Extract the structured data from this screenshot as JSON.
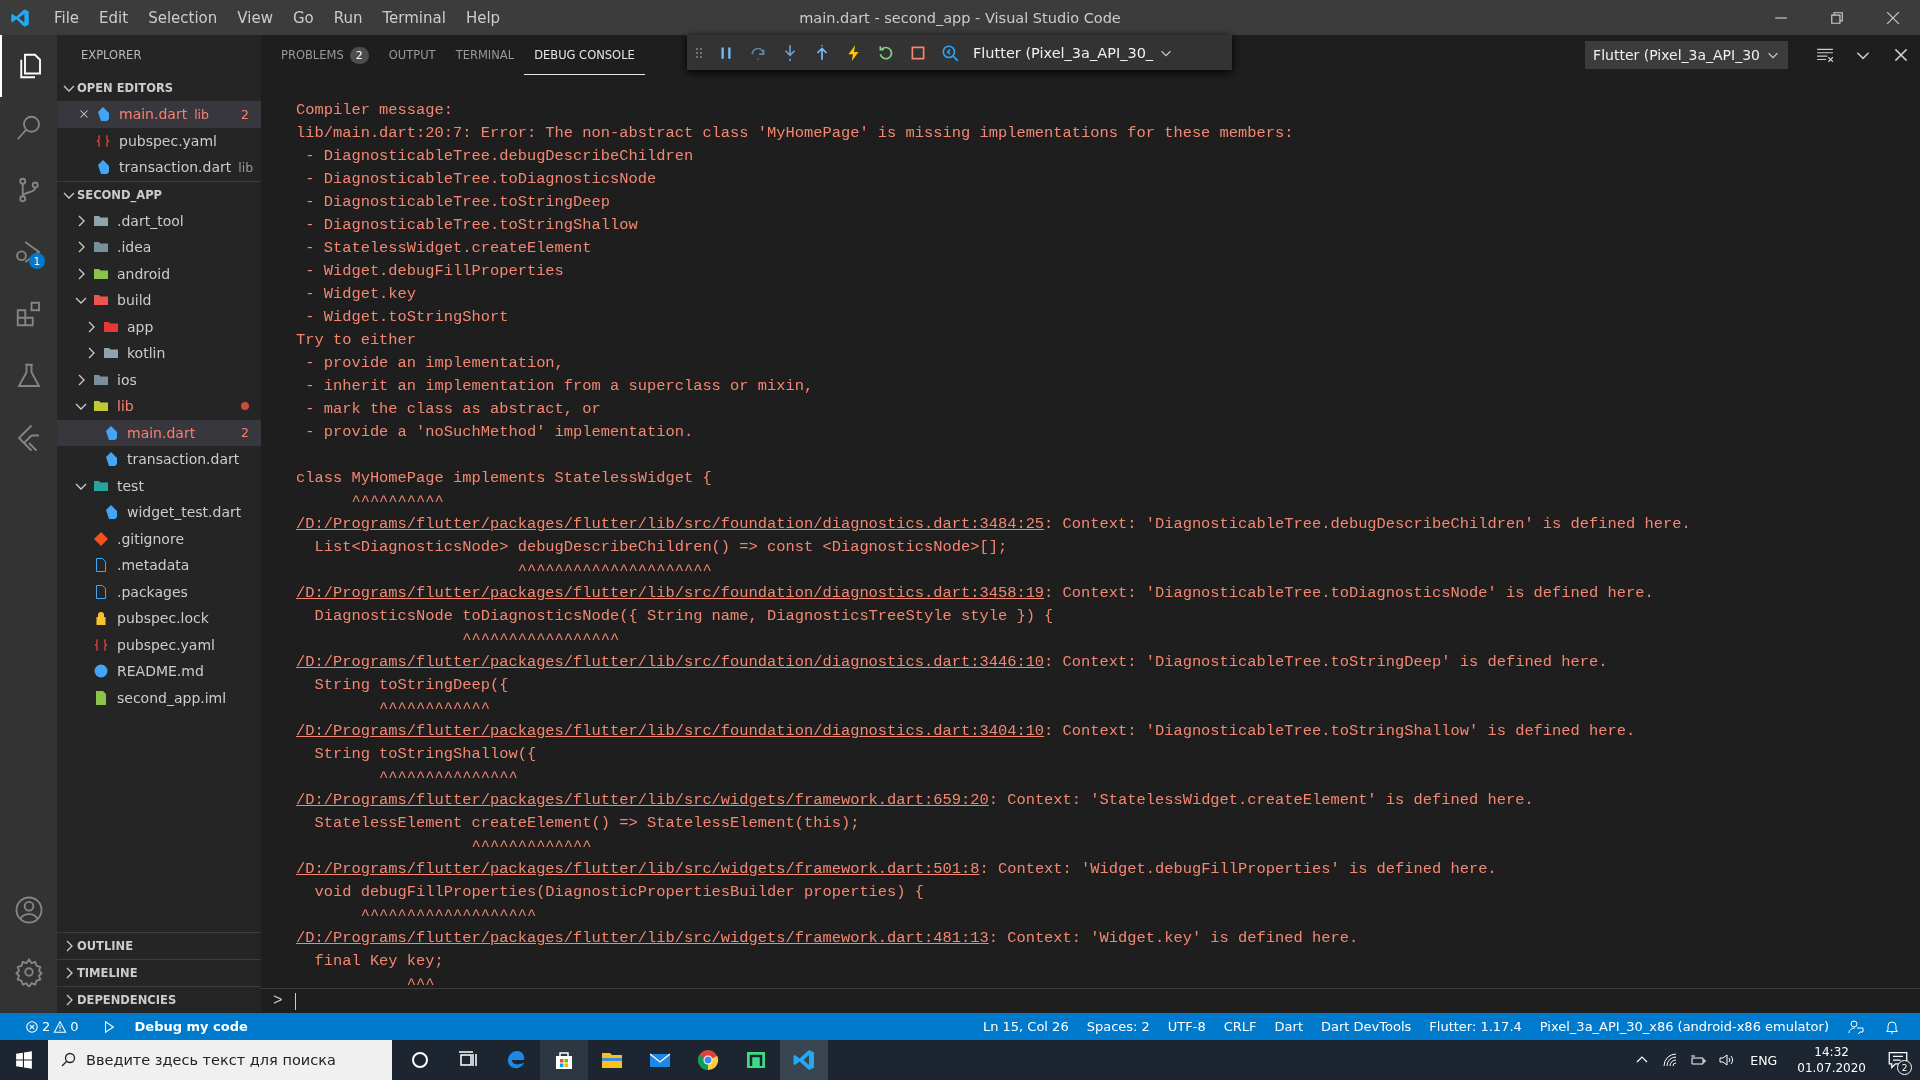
{
  "menu": [
    "File",
    "Edit",
    "Selection",
    "View",
    "Go",
    "Run",
    "Terminal",
    "Help"
  ],
  "window": {
    "title": "main.dart - second_app - Visual Studio Code"
  },
  "activity_bar": [
    {
      "kind": "files",
      "selected": true
    },
    {
      "kind": "search",
      "selected": false
    },
    {
      "kind": "scm",
      "selected": false
    },
    {
      "kind": "debug",
      "selected": false,
      "badge": "1"
    },
    {
      "kind": "extensions",
      "selected": false
    },
    {
      "kind": "testing",
      "selected": false
    },
    {
      "kind": "flutter",
      "selected": false
    }
  ],
  "activity_bottom": [
    {
      "kind": "account"
    },
    {
      "kind": "settings"
    }
  ],
  "explorer": {
    "title": "EXPLORER",
    "open_editors": {
      "title": "OPEN EDITORS",
      "expanded": true,
      "items": [
        {
          "name": "main.dart",
          "detail": "lib",
          "problems": "2",
          "error": true,
          "selected": true,
          "kind": "dart"
        },
        {
          "name": "pubspec.yaml",
          "error": false,
          "selected": false,
          "kind": "yaml"
        },
        {
          "name": "transaction.dart",
          "detail": "lib",
          "error": false,
          "selected": false,
          "kind": "dart"
        }
      ]
    },
    "project": {
      "title": "SECOND_APP",
      "expanded": true
    },
    "tree": [
      {
        "name": ".dart_tool",
        "kind": "folder",
        "expanded": false,
        "selected": false,
        "error": false
      },
      {
        "name": ".idea",
        "kind": "folder-idea",
        "expanded": false,
        "selected": false,
        "error": false
      },
      {
        "name": "android",
        "kind": "folder-android",
        "expanded": false,
        "selected": false,
        "error": false
      },
      {
        "name": "build",
        "kind": "folder-build",
        "expanded": true,
        "selected": false,
        "error": false,
        "children": [
          {
            "name": "app",
            "kind": "folder-app",
            "expanded": false,
            "selected": false,
            "error": false
          },
          {
            "name": "kotlin",
            "kind": "folder",
            "expanded": false,
            "selected": false,
            "error": false
          }
        ]
      },
      {
        "name": "ios",
        "kind": "folder-ios",
        "expanded": false,
        "selected": false,
        "error": false
      },
      {
        "name": "lib",
        "kind": "folder-lib",
        "expanded": true,
        "selected": false,
        "error": true,
        "dot": true,
        "children": [
          {
            "name": "main.dart",
            "kind": "dart",
            "selected": true,
            "error": true,
            "problems": "2"
          },
          {
            "name": "transaction.dart",
            "kind": "dart",
            "selected": false,
            "error": false
          }
        ]
      },
      {
        "name": "test",
        "kind": "folder-test",
        "expanded": true,
        "selected": false,
        "error": false,
        "children": [
          {
            "name": "widget_test.dart",
            "kind": "dart",
            "selected": false,
            "error": false
          }
        ]
      },
      {
        "name": ".gitignore",
        "kind": "git",
        "selected": false,
        "error": false
      },
      {
        "name": ".metadata",
        "kind": "doc",
        "selected": false,
        "error": false
      },
      {
        "name": ".packages",
        "kind": "doc",
        "selected": false,
        "error": false
      },
      {
        "name": "pubspec.lock",
        "kind": "lock",
        "selected": false,
        "error": false
      },
      {
        "name": "pubspec.yaml",
        "kind": "yaml",
        "selected": false,
        "error": false
      },
      {
        "name": "README.md",
        "kind": "info",
        "selected": false,
        "error": false
      },
      {
        "name": "second_app.iml",
        "kind": "iml",
        "selected": false,
        "error": false
      }
    ],
    "bottom_sections": [
      {
        "title": "OUTLINE",
        "expanded": false
      },
      {
        "title": "TIMELINE",
        "expanded": false
      },
      {
        "title": "DEPENDENCIES",
        "expanded": false
      }
    ]
  },
  "panel": {
    "tabs": [
      {
        "label": "PROBLEMS",
        "badge": "2",
        "selected": false
      },
      {
        "label": "OUTPUT",
        "selected": false
      },
      {
        "label": "TERMINAL",
        "selected": false
      },
      {
        "label": "DEBUG CONSOLE",
        "selected": true
      }
    ],
    "session_dropdown": "Flutter (Pixel_3a_API_30",
    "debug_toolbar": {
      "buttons": [
        {
          "kind": "pause"
        },
        {
          "kind": "step-over"
        },
        {
          "kind": "step-into"
        },
        {
          "kind": "step-out"
        },
        {
          "kind": "hot-reload"
        },
        {
          "kind": "restart"
        },
        {
          "kind": "stop"
        },
        {
          "kind": "devtools"
        }
      ],
      "session": "Flutter (Pixel_3a_API_30_"
    },
    "console": [
      {
        "kind": "text",
        "text": "Compiler message:"
      },
      {
        "kind": "text",
        "text": "lib/main.dart:20:7: Error: The non-abstract class 'MyHomePage' is missing implementations for these members:"
      },
      {
        "kind": "text",
        "text": " - DiagnosticableTree.debugDescribeChildren"
      },
      {
        "kind": "text",
        "text": " - DiagnosticableTree.toDiagnosticsNode"
      },
      {
        "kind": "text",
        "text": " - DiagnosticableTree.toStringDeep"
      },
      {
        "kind": "text",
        "text": " - DiagnosticableTree.toStringShallow"
      },
      {
        "kind": "text",
        "text": " - StatelessWidget.createElement"
      },
      {
        "kind": "text",
        "text": " - Widget.debugFillProperties"
      },
      {
        "kind": "text",
        "text": " - Widget.key"
      },
      {
        "kind": "text",
        "text": " - Widget.toStringShort"
      },
      {
        "kind": "text",
        "text": "Try to either"
      },
      {
        "kind": "text",
        "text": " - provide an implementation,"
      },
      {
        "kind": "text",
        "text": " - inherit an implementation from a superclass or mixin,"
      },
      {
        "kind": "text",
        "text": " - mark the class as abstract, or"
      },
      {
        "kind": "text",
        "text": " - provide a 'noSuchMethod' implementation."
      },
      {
        "kind": "blank"
      },
      {
        "kind": "text",
        "text": "class MyHomePage implements StatelessWidget {"
      },
      {
        "kind": "text",
        "text": "      ^^^^^^^^^^"
      },
      {
        "kind": "link",
        "link": "/D:/Programs/flutter/packages/flutter/lib/src/foundation/diagnostics.dart:3484:25",
        "text": ": Context: 'DiagnosticableTree.debugDescribeChildren' is defined here."
      },
      {
        "kind": "text",
        "text": "  List<DiagnosticsNode> debugDescribeChildren() => const <DiagnosticsNode>[];"
      },
      {
        "kind": "text",
        "text": "                        ^^^^^^^^^^^^^^^^^^^^^"
      },
      {
        "kind": "link",
        "link": "/D:/Programs/flutter/packages/flutter/lib/src/foundation/diagnostics.dart:3458:19",
        "text": ": Context: 'DiagnosticableTree.toDiagnosticsNode' is defined here."
      },
      {
        "kind": "text",
        "text": "  DiagnosticsNode toDiagnosticsNode({ String name, DiagnosticsTreeStyle style }) {"
      },
      {
        "kind": "text",
        "text": "                  ^^^^^^^^^^^^^^^^^"
      },
      {
        "kind": "link",
        "link": "/D:/Programs/flutter/packages/flutter/lib/src/foundation/diagnostics.dart:3446:10",
        "text": ": Context: 'DiagnosticableTree.toStringDeep' is defined here."
      },
      {
        "kind": "text",
        "text": "  String toStringDeep({"
      },
      {
        "kind": "text",
        "text": "         ^^^^^^^^^^^^"
      },
      {
        "kind": "link",
        "link": "/D:/Programs/flutter/packages/flutter/lib/src/foundation/diagnostics.dart:3404:10",
        "text": ": Context: 'DiagnosticableTree.toStringShallow' is defined here."
      },
      {
        "kind": "text",
        "text": "  String toStringShallow({"
      },
      {
        "kind": "text",
        "text": "         ^^^^^^^^^^^^^^^"
      },
      {
        "kind": "link",
        "link": "/D:/Programs/flutter/packages/flutter/lib/src/widgets/framework.dart:659:20",
        "text": ": Context: 'StatelessWidget.createElement' is defined here."
      },
      {
        "kind": "text",
        "text": "  StatelessElement createElement() => StatelessElement(this);"
      },
      {
        "kind": "text",
        "text": "                   ^^^^^^^^^^^^^"
      },
      {
        "kind": "link",
        "link": "/D:/Programs/flutter/packages/flutter/lib/src/widgets/framework.dart:501:8",
        "text": ": Context: 'Widget.debugFillProperties' is defined here."
      },
      {
        "kind": "text",
        "text": "  void debugFillProperties(DiagnosticPropertiesBuilder properties) {"
      },
      {
        "kind": "text",
        "text": "       ^^^^^^^^^^^^^^^^^^^"
      },
      {
        "kind": "link",
        "link": "/D:/Programs/flutter/packages/flutter/lib/src/widgets/framework.dart:481:13",
        "text": ": Context: 'Widget.key' is defined here."
      },
      {
        "kind": "text",
        "text": "  final Key key;"
      },
      {
        "kind": "text",
        "text": "            ^^^"
      }
    ],
    "prompt": ">"
  },
  "status_bar": {
    "errors": "2",
    "warnings": "0",
    "launch": "Debug my code",
    "items": [
      "Ln 15, Col 26",
      "Spaces: 2",
      "UTF-8",
      "CRLF",
      "Dart",
      "Dart DevTools",
      "Flutter: 1.17.4",
      "Pixel_3a_API_30_x86 (android-x86 emulator)"
    ]
  },
  "taskbar": {
    "search_placeholder": "Введите здесь текст для поиска",
    "apps": [
      {
        "kind": "cortana",
        "active": false
      },
      {
        "kind": "task-view",
        "active": false
      },
      {
        "kind": "edge",
        "active": false
      },
      {
        "kind": "store",
        "active": true
      },
      {
        "kind": "explorer",
        "active": false
      },
      {
        "kind": "mail",
        "active": false
      },
      {
        "kind": "chrome",
        "active": false
      },
      {
        "kind": "green-app",
        "active": false
      },
      {
        "kind": "vscode",
        "active": true
      }
    ],
    "language": "ENG",
    "time": "14:32",
    "date": "01.07.2020",
    "notifications": "2"
  }
}
